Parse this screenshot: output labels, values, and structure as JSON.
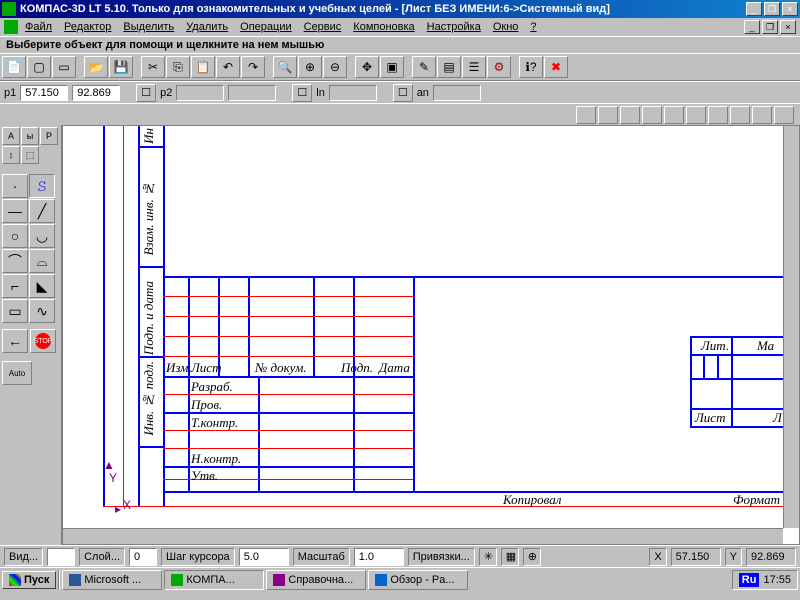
{
  "title": "КОМПАС-3D LT 5.10. Только для ознакомительных и учебных целей - [Лист БЕЗ ИМЕНИ:6->Системный вид]",
  "menu": [
    "Файл",
    "Редактор",
    "Выделить",
    "Удалить",
    "Операции",
    "Сервис",
    "Компоновка",
    "Настройка",
    "Окно",
    "?"
  ],
  "hint": "Выберите объект для помощи и щелкните на нем мышью",
  "coord": {
    "p1": "p1",
    "p1x": "57.150",
    "p1y": "92.869",
    "p2": "p2",
    "lnlab": "ln",
    "anlab": "an"
  },
  "leftpanel": {
    "a": "A",
    "b": "ы",
    "c": "Р",
    "auto": "Auto"
  },
  "stamp": {
    "col_izm": "Изм.",
    "col_list": "Лист",
    "col_ndoc": "№ докум.",
    "col_podp": "Подп.",
    "col_data": "Дата",
    "razrab": "Разраб.",
    "prov": "Пров.",
    "tkontr": "Т.контр.",
    "nkontr": "Н.контр.",
    "utv": "Утв.",
    "kopir": "Копировал",
    "format": "Формат",
    "lit": "Лит.",
    "ma": "Ма",
    "list": "Лист",
    "l": "Л",
    "v1": "Инв. № подл.",
    "v2": "Подп. и дата",
    "v3": "Взам. инв. №",
    "v4": "Ин"
  },
  "axis": {
    "x": "X",
    "y": "Y"
  },
  "status": {
    "vid": "Вид...",
    "vidv": "",
    "sloy": "Слой...",
    "sloyv": "0",
    "shag": "Шаг курсора",
    "shagv": "5.0",
    "mash": "Масштаб",
    "mashv": "1.0",
    "priv": "Привязки...",
    "x": "X",
    "xv": "57.150",
    "y": "Y",
    "yv": "92.869"
  },
  "taskbar": {
    "start": "Пуск",
    "t1": "Microsoft ...",
    "t2": "КОМПА...",
    "t3": "Справочна...",
    "t4": "Обзор - Pa...",
    "lang": "Ru",
    "clock": "17:55"
  }
}
